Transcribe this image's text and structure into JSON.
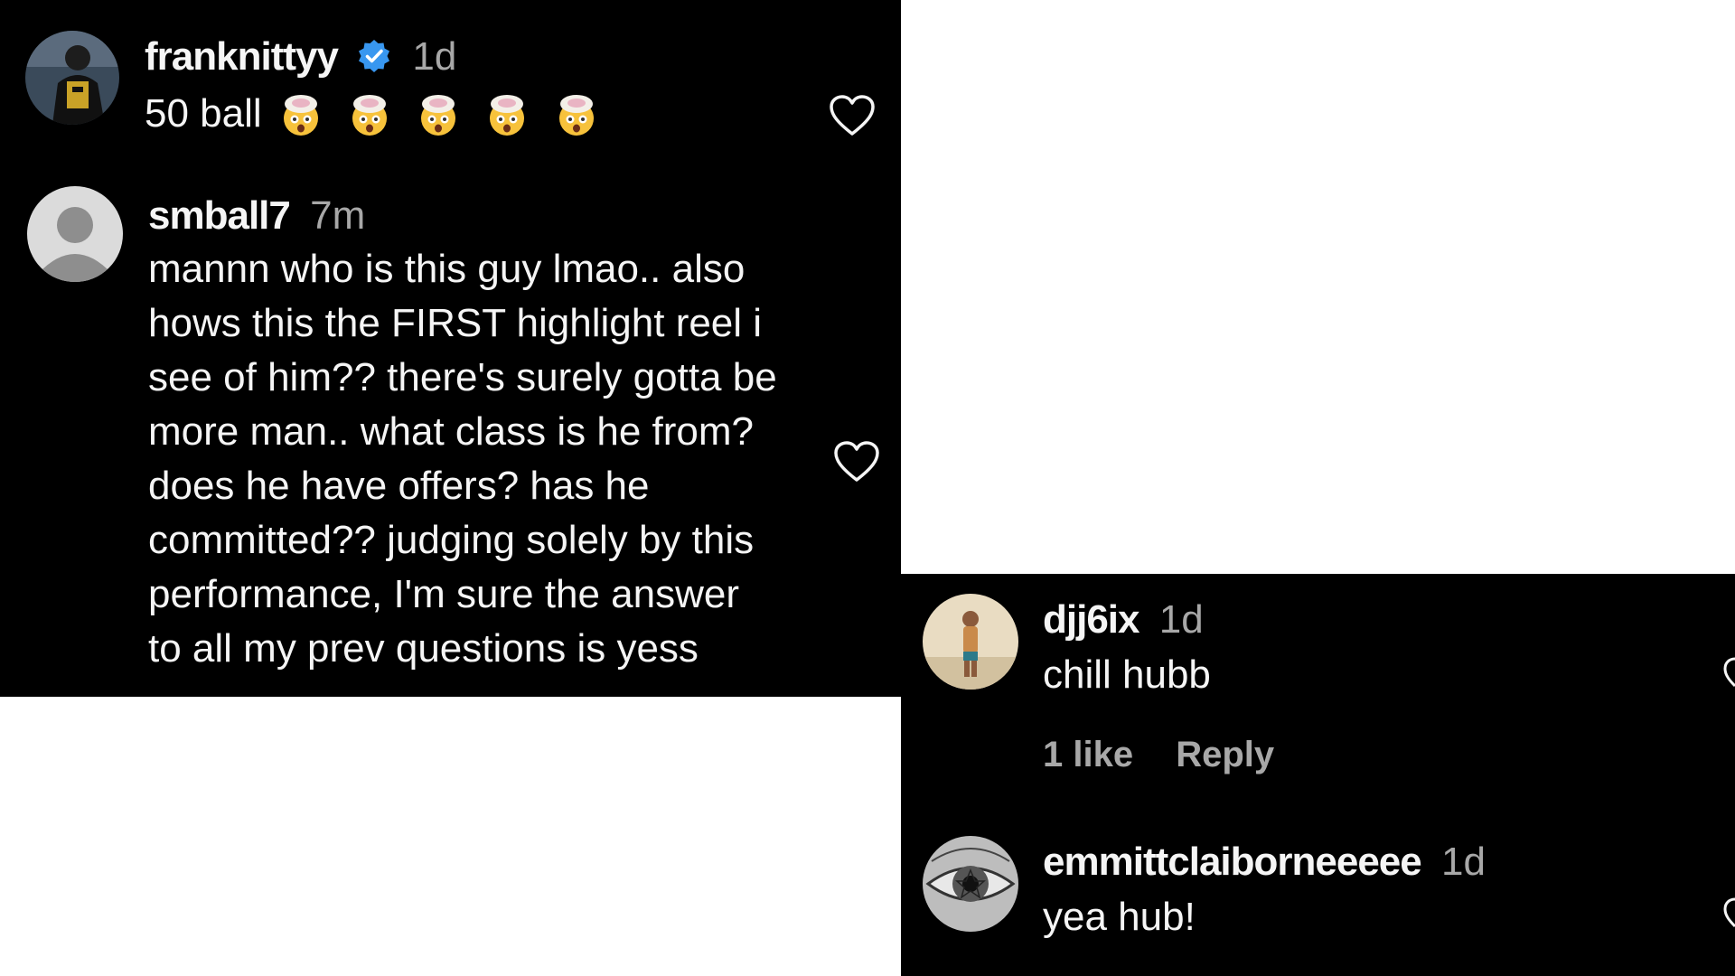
{
  "comments": [
    {
      "username": "franknittyy",
      "verified": true,
      "time": "1d",
      "text": "50 ball",
      "emoji": [
        "exploding-head-emoji",
        "exploding-head-emoji",
        "exploding-head-emoji",
        "exploding-head-emoji",
        "exploding-head-emoji"
      ],
      "avatar": "player-photo-avatar"
    },
    {
      "username": "smball7",
      "time": "7m",
      "text_lines": [
        "mannn who is this guy lmao.. also",
        "hows this the FIRST highlight reel i",
        "see of him?? there's surely gotta be",
        "more man.. what class is he from?",
        "does he have offers? has he",
        "committed?? judging solely by this",
        "performance, I'm sure the answer",
        "to all my prev questions is yess"
      ],
      "avatar": "default-profile-avatar"
    },
    {
      "username": "djj6ix",
      "time": "1d",
      "text": "chill hubb",
      "likes": "1 like",
      "reply": "Reply",
      "avatar": "person-photo-avatar"
    },
    {
      "username": "emmittclaiborneeeee",
      "time": "1d",
      "text": "yea hub!",
      "avatar": "eye-art-avatar"
    }
  ],
  "colors": {
    "background": "#000000",
    "text": "#f5f5f5",
    "muted": "#a8a8a8",
    "verified": "#3897f0"
  },
  "icons": {
    "like": "heart-outline-icon",
    "verified": "verified-badge-icon"
  }
}
